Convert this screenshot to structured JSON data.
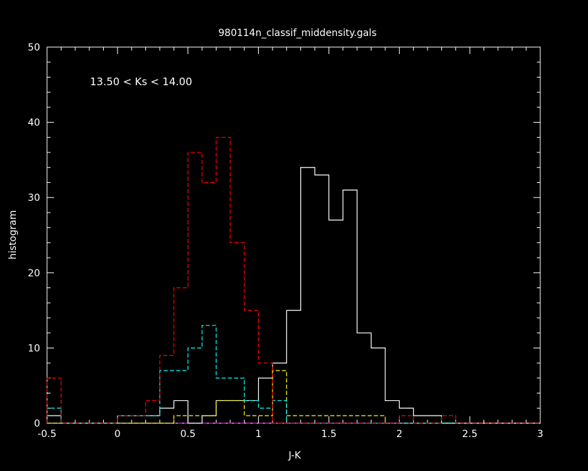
{
  "chart_data": {
    "type": "bar",
    "title": "980114n_classif_middensity.gals",
    "xlabel": "J-K",
    "ylabel": "histogram",
    "annotation": "13.50 < Ks < 14.00",
    "xlim": [
      -0.5,
      3.0
    ],
    "ylim": [
      0,
      50
    ],
    "xticks": [
      -0.5,
      0,
      0.5,
      1,
      1.5,
      2,
      2.5,
      3
    ],
    "xtick_labels": [
      "-0.5",
      "0",
      "0.5",
      "1",
      "1.5",
      "2",
      "2.5",
      "3"
    ],
    "yticks": [
      0,
      10,
      20,
      30,
      40,
      50
    ],
    "ytick_labels": [
      "0",
      "10",
      "20",
      "30",
      "40",
      "50"
    ],
    "bin_start": -0.5,
    "bin_width": 0.1,
    "grid": false,
    "series": [
      {
        "color": "#ffffff",
        "dashed": false,
        "values": [
          1,
          0,
          0,
          0,
          0,
          1,
          1,
          1,
          2,
          3,
          0,
          1,
          3,
          3,
          3,
          6,
          8,
          15,
          34,
          33,
          27,
          31,
          12,
          10,
          3,
          2,
          1,
          1,
          0,
          0,
          0,
          0,
          0,
          0,
          0
        ]
      },
      {
        "color": "#ff0000",
        "dashed": true,
        "values": [
          6,
          0,
          0,
          0,
          0,
          1,
          1,
          3,
          9,
          18,
          36,
          32,
          38,
          24,
          15,
          8,
          0,
          0,
          0,
          0,
          0,
          0,
          0,
          0,
          0,
          1,
          0,
          0,
          1,
          0,
          0,
          0,
          0,
          0,
          0
        ]
      },
      {
        "color": "#00ffff",
        "dashed": true,
        "values": [
          2,
          0,
          0,
          0,
          0,
          1,
          1,
          1,
          7,
          7,
          10,
          13,
          6,
          6,
          3,
          2,
          3,
          0,
          0,
          0,
          0,
          0,
          0,
          0,
          0,
          0,
          0,
          0,
          0,
          0,
          0,
          0,
          0,
          0,
          0
        ]
      },
      {
        "color": "#ffff00",
        "dashed": true,
        "values": [
          0,
          0,
          0,
          0,
          0,
          0,
          0,
          0,
          0,
          1,
          1,
          1,
          3,
          3,
          1,
          1,
          7,
          1,
          1,
          1,
          1,
          1,
          1,
          1,
          0,
          0,
          0,
          0,
          0,
          0,
          0,
          0,
          0,
          0,
          0
        ]
      },
      {
        "color": "#ff00ff",
        "dashed": true,
        "values": [
          0,
          0,
          0,
          0,
          0,
          0,
          0,
          0,
          0,
          0,
          0,
          0,
          0,
          0,
          0,
          0,
          0,
          0,
          0,
          0,
          0,
          0,
          0,
          0,
          0,
          0,
          0,
          0,
          0,
          0,
          0,
          0,
          0,
          0,
          0
        ]
      }
    ]
  }
}
